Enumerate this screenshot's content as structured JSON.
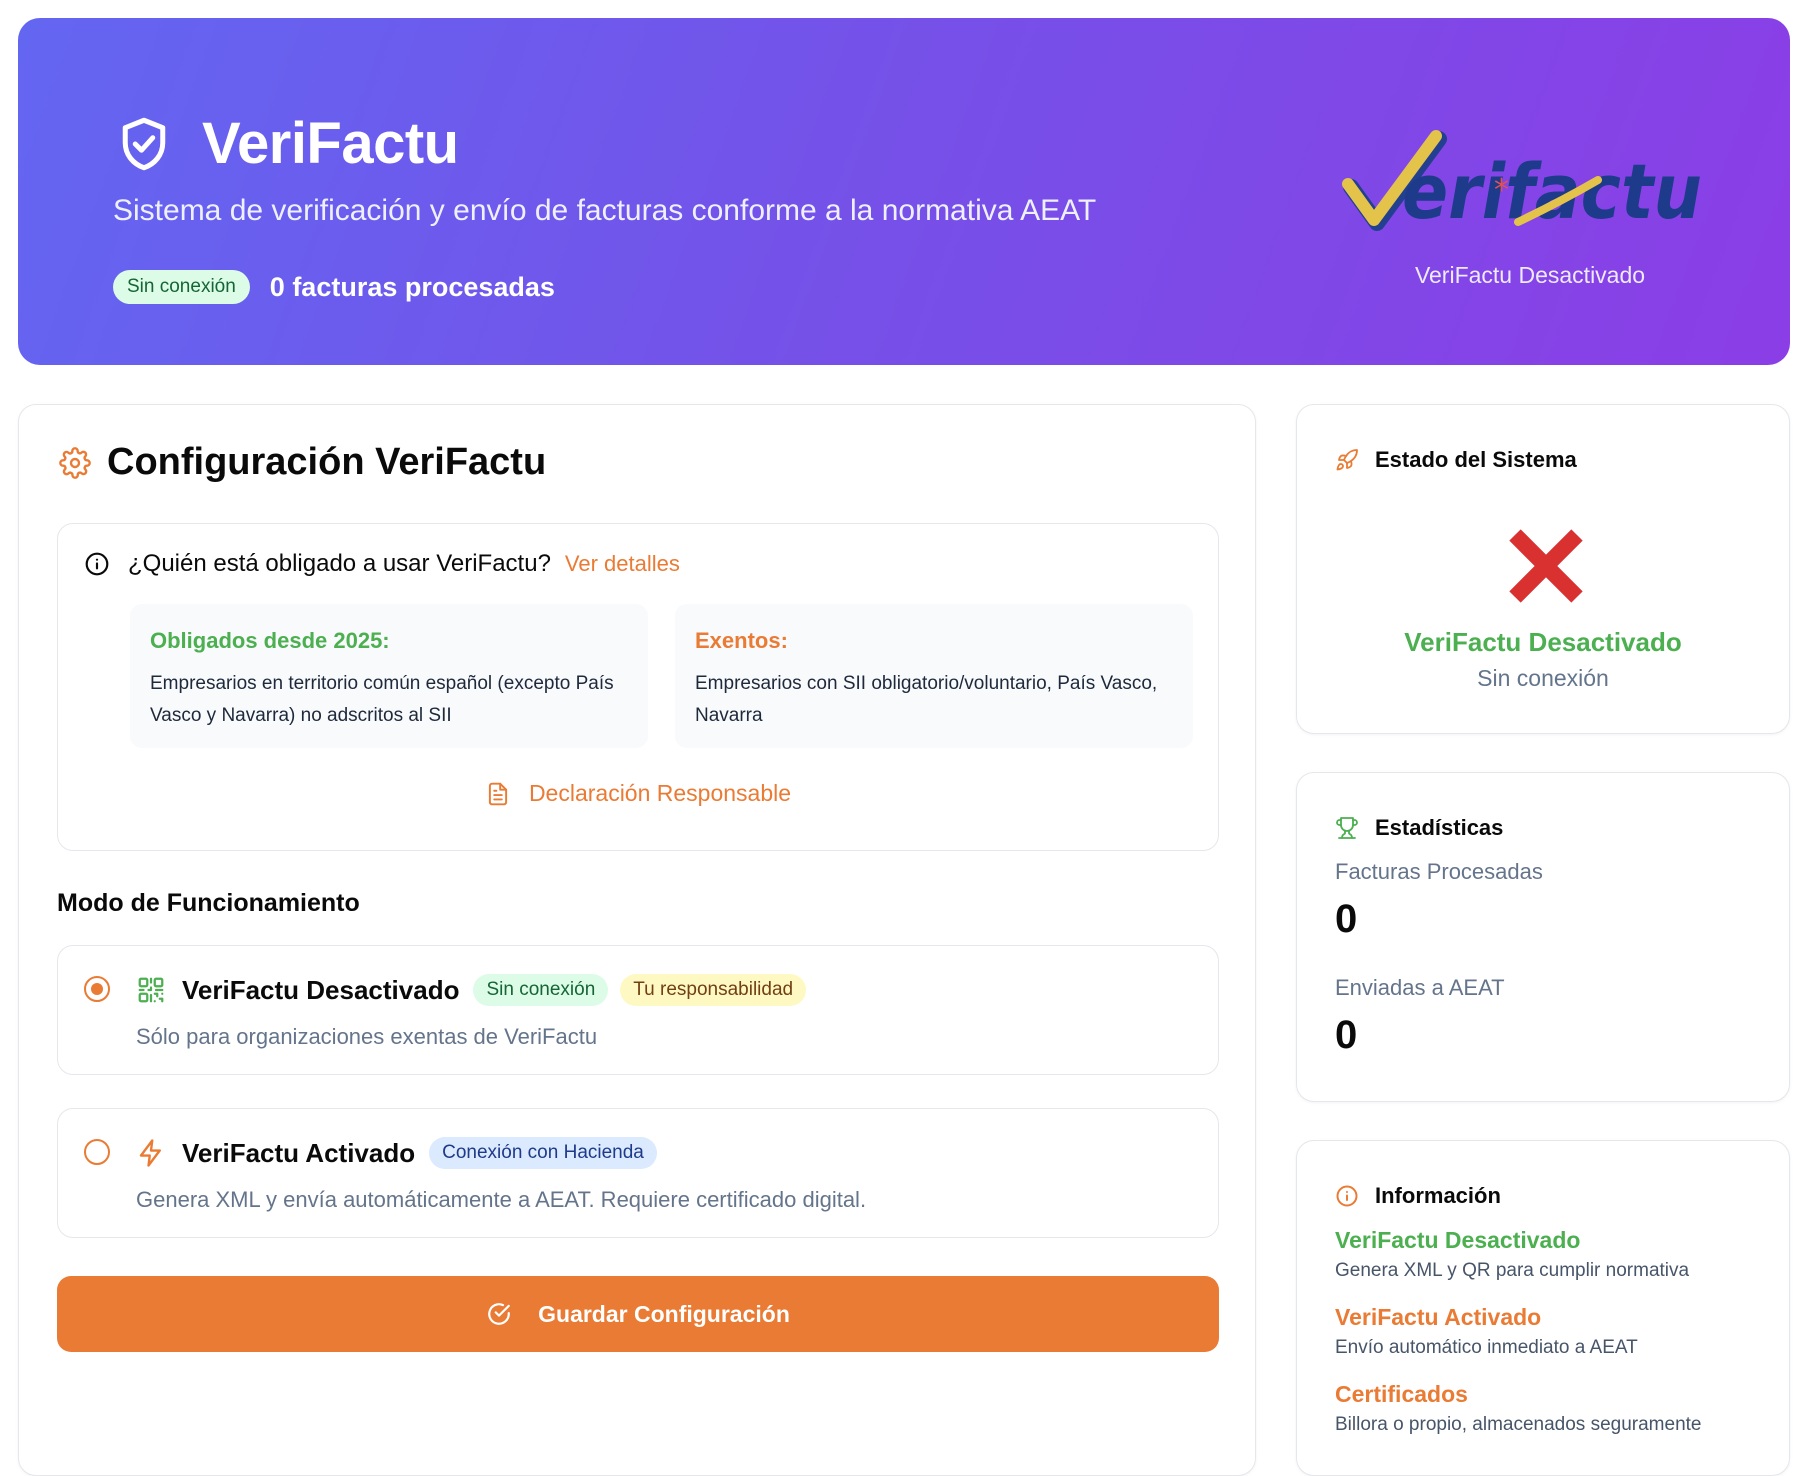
{
  "header": {
    "title": "VeriFactu",
    "subtitle": "Sistema de verificación y envío de facturas conforme a la normativa AEAT",
    "status_badge": "Sin conexión",
    "processed_text": "0 facturas procesadas",
    "logo_caption": "VeriFactu Desactivado"
  },
  "config": {
    "title": "Configuración VeriFactu",
    "question": "¿Quién está obligado a usar VeriFactu?",
    "details_link": "Ver detalles",
    "obligados_title": "Obligados desde 2025:",
    "obligados_text": "Empresarios en territorio común español (excepto País Vasco y Navarra) no adscritos al SII",
    "exentos_title": "Exentos:",
    "exentos_text": "Empresarios con SII obligatorio/voluntario, País Vasco, Navarra",
    "declaration_link": "Declaración Responsable",
    "mode_title": "Modo de Funcionamiento",
    "options": [
      {
        "label": "VeriFactu Desactivado",
        "badges": [
          "Sin conexión",
          "Tu responsabilidad"
        ],
        "description": "Sólo para organizaciones exentas de VeriFactu",
        "selected": true,
        "icon": "qr-code-icon"
      },
      {
        "label": "VeriFactu Activado",
        "badges": [
          "Conexión con Hacienda"
        ],
        "description": "Genera XML y envía automáticamente a AEAT. Requiere certificado digital.",
        "selected": false,
        "icon": "lightning-icon"
      }
    ],
    "save_label": "Guardar Configuración"
  },
  "system_status": {
    "title": "Estado del Sistema",
    "main": "VeriFactu Desactivado",
    "sub": "Sin conexión"
  },
  "stats": {
    "title": "Estadísticas",
    "processed_label": "Facturas Procesadas",
    "processed_value": "0",
    "sent_label": "Enviadas a AEAT",
    "sent_value": "0"
  },
  "info": {
    "title": "Información",
    "items": [
      {
        "title": "VeriFactu Desactivado",
        "desc": "Genera XML y QR para cumplir normativa"
      },
      {
        "title": "VeriFactu Activado",
        "desc": "Envío automático inmediato a AEAT"
      },
      {
        "title": "Certificados",
        "desc": "Billora o propio, almacenados seguramente"
      }
    ]
  },
  "colors": {
    "accent": "#ea7b34",
    "success": "#4caf50",
    "hero_start": "#6366f1",
    "hero_end": "#8b3ee6"
  }
}
